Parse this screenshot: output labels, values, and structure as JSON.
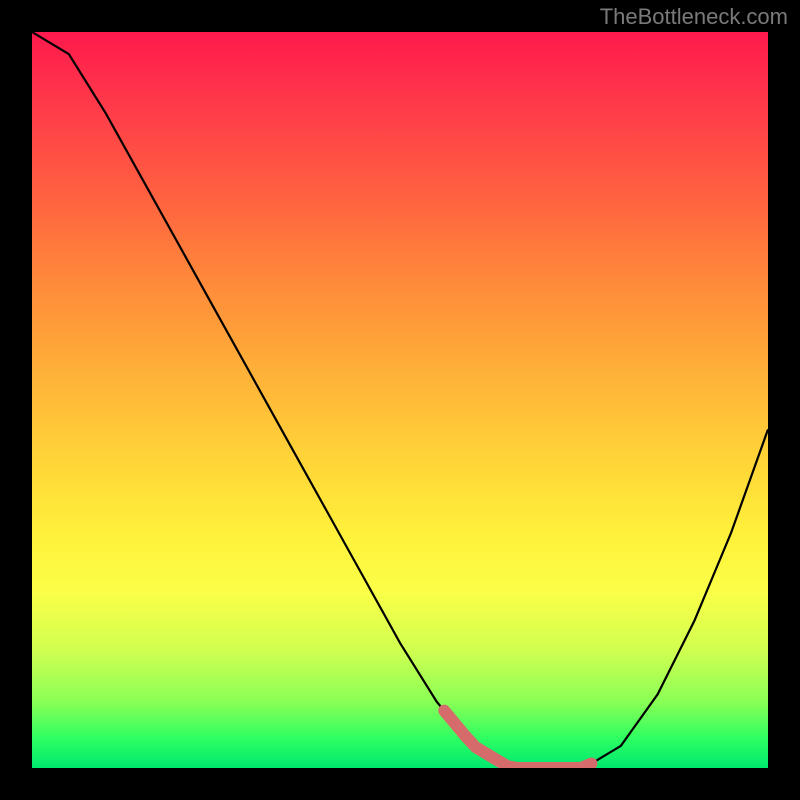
{
  "watermark": "TheBottleneck.com",
  "chart_data": {
    "type": "line",
    "title": "",
    "xlabel": "",
    "ylabel": "",
    "xlim": [
      0,
      100
    ],
    "ylim": [
      0,
      100
    ],
    "x": [
      0,
      5,
      10,
      15,
      20,
      25,
      30,
      35,
      40,
      45,
      50,
      55,
      60,
      65,
      70,
      75,
      80,
      85,
      90,
      95,
      100
    ],
    "values": [
      100,
      97,
      89,
      80,
      71,
      62,
      53,
      44,
      35,
      26,
      17,
      9,
      3,
      0,
      0,
      0,
      3,
      10,
      20,
      32,
      46
    ],
    "highlight_x_range": [
      56,
      76
    ],
    "gradient_colors": {
      "top": "#ff1a4d",
      "mid": "#ffd438",
      "bottom": "#00e86f"
    }
  }
}
